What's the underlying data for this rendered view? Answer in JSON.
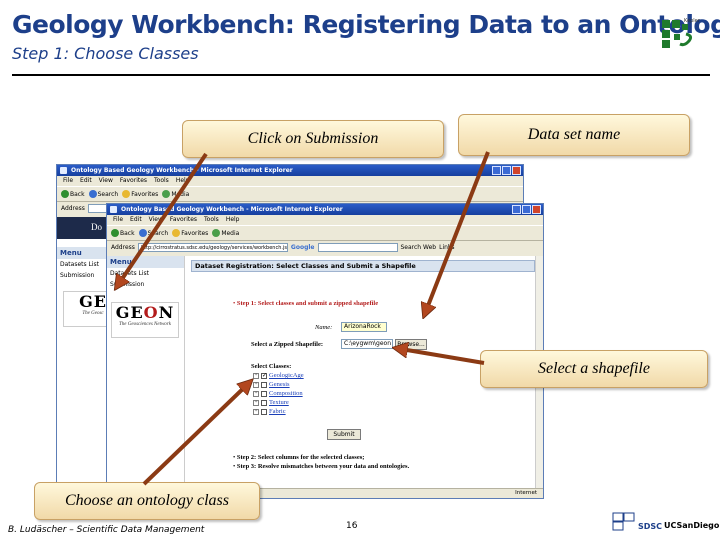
{
  "slide": {
    "title": "Geology Workbench: Registering Data to an Ontology",
    "subtitle": "Step 1: Choose Classes",
    "logo_name": "kepler-logo",
    "footer_left": "B. Ludäscher – Scientific Data Management",
    "page_number": "16",
    "sdsc_label": "SDSC",
    "ucsd_label": "UCSanDiego"
  },
  "callouts": {
    "submission": "Click on Submission",
    "dataset_name": "Data set name",
    "shapefile": "Select a shapefile",
    "ontology_class": "Choose an ontology class"
  },
  "back_window": {
    "title": "Ontology Based Geology Workbench - Microsoft Internet Explorer",
    "menu": [
      "File",
      "Edit",
      "View",
      "Favorites",
      "Tools",
      "Help"
    ],
    "toolbar": {
      "back": "Back",
      "search": "Search",
      "favorites": "Favorites",
      "media": "Media"
    },
    "address_label": "Address",
    "page_heading_fragment": "Do",
    "side_menu_title": "Menu",
    "side_links": [
      "Datasets List",
      "Submission"
    ]
  },
  "front_window": {
    "title": "Ontology Based Geology Workbench - Microsoft Internet Explorer",
    "menu": [
      "File",
      "Edit",
      "View",
      "Favorites",
      "Tools",
      "Help"
    ],
    "toolbar": {
      "back": "Back",
      "search": "Search",
      "favorites": "Favorites",
      "media": "Media"
    },
    "address_label": "Address",
    "address_value": "http://cirrostratus.sdsc.edu/geology/services/workbench.jsp",
    "google_label": "Google",
    "search_web": "Search Web",
    "links": "Links",
    "side_menu_title": "Menu",
    "side_links": [
      "Datasets List",
      "Submission"
    ],
    "geon_logo_text": "GEON",
    "geon_tagline": "The Geosciences Network",
    "banner": "Dataset Registration: Select Classes and Submit a Shapefile",
    "step1": "Step 1: Select classes and submit a zipped shapefile",
    "name_label": "Name:",
    "name_value": "ArizonaRock",
    "shapefile_label": "Select a Zipped Shapefile:",
    "shapefile_value": "C:\\eygwm\\geon",
    "browse_label": "Browse...",
    "select_classes_label": "Select Classes:",
    "classes": [
      {
        "label": "GeologicAge",
        "checked": true
      },
      {
        "label": "Genesis",
        "checked": false
      },
      {
        "label": "Composition",
        "checked": false
      },
      {
        "label": "Texture",
        "checked": false
      },
      {
        "label": "Fabric",
        "checked": false
      }
    ],
    "submit_label": "Submit",
    "step2": "Step 2: Select columns for the selected classes;",
    "step3": "Step 3: Resolve mismatches between your data and ontologies.",
    "status_zone": "Internet"
  }
}
